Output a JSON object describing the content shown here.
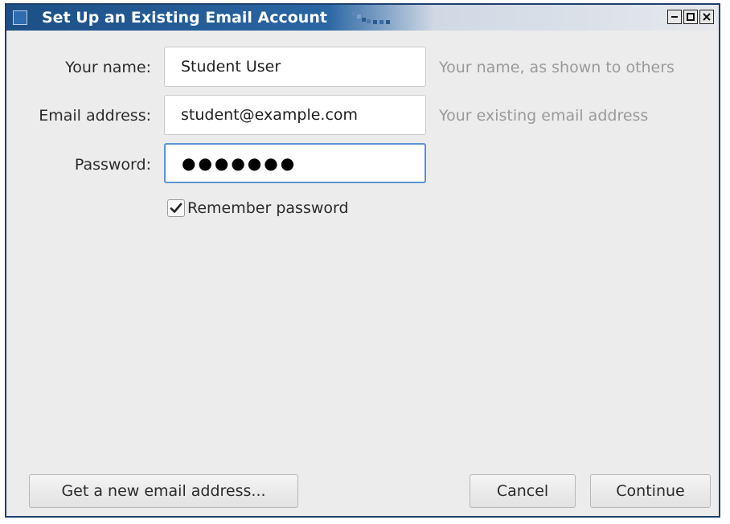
{
  "window": {
    "title": "Set Up an Existing Email Account"
  },
  "form": {
    "name": {
      "label": "Your name:",
      "value": "Student User",
      "hint": "Your name, as shown to others"
    },
    "email": {
      "label": "Email address:",
      "value": "student@example.com",
      "hint": "Your existing email address"
    },
    "password": {
      "label": "Password:",
      "value": "●●●●●●●"
    },
    "remember": {
      "label": "Remember password",
      "checked": true
    }
  },
  "buttons": {
    "new_address": "Get a new email address...",
    "cancel": "Cancel",
    "continue": "Continue"
  },
  "colors": {
    "titlebar": "#1d4f86",
    "focus_border": "#5b93d3",
    "hint_text": "#9a9a9a"
  },
  "icons": {
    "window": "window-icon",
    "minimize": "minimize-icon",
    "maximize": "maximize-icon",
    "close": "close-icon",
    "checkmark": "checkmark-icon"
  }
}
